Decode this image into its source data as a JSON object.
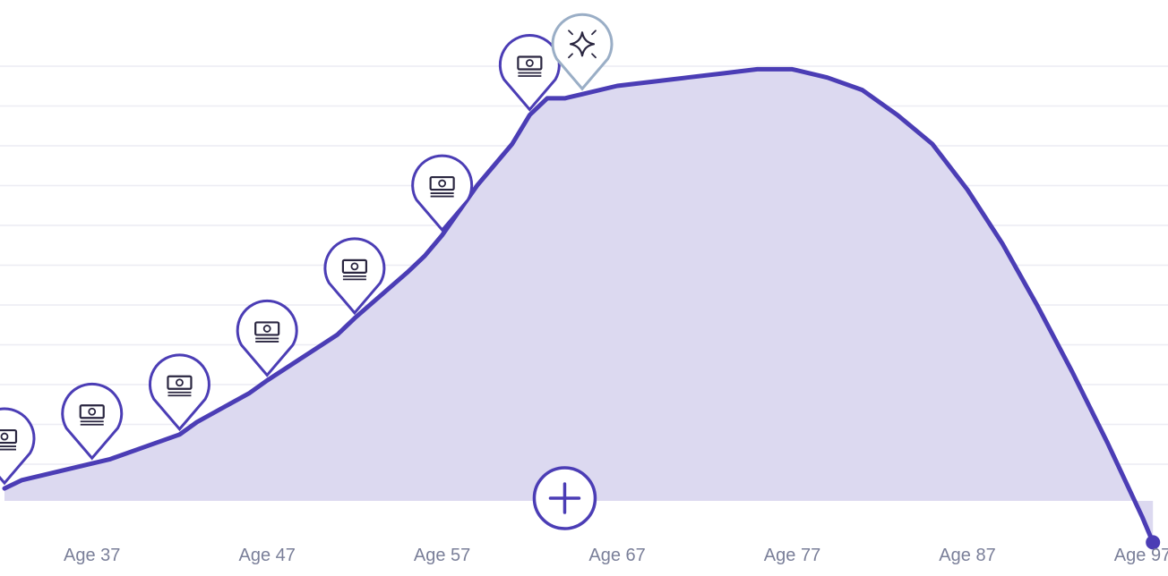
{
  "chart_data": {
    "type": "area",
    "title": "",
    "xlabel": "",
    "ylabel": "",
    "xlim": [
      32,
      98
    ],
    "ylim": [
      0,
      100
    ],
    "grid": true,
    "tick_labels": [
      "Age 37",
      "Age 47",
      "Age 57",
      "Age 67",
      "Age 77",
      "Age 87",
      "Age 97"
    ],
    "tick_values": [
      37,
      47,
      57,
      67,
      77,
      87,
      97
    ],
    "series": [
      {
        "x": [
          32,
          33,
          37,
          38,
          42,
          43,
          46,
          47,
          51,
          52,
          55,
          56,
          57,
          59,
          61,
          62,
          63,
          64,
          65,
          67,
          69,
          71,
          73,
          75,
          77,
          79,
          81,
          83,
          85,
          87,
          89,
          91,
          93,
          95,
          97,
          97.6
        ],
        "y": [
          3,
          5,
          9,
          10,
          16,
          19,
          26,
          29,
          40,
          44,
          55,
          59,
          64,
          76,
          86,
          93,
          97,
          97,
          98,
          100,
          101,
          102,
          103,
          104,
          104,
          102,
          99,
          93,
          86,
          75,
          62,
          47,
          31,
          14,
          -4,
          -10
        ],
        "color": "#4b3db5",
        "fill": "#dcd9f0"
      }
    ],
    "markers": [
      {
        "age": 32,
        "icon": "cash-icon"
      },
      {
        "age": 37,
        "icon": "cash-icon"
      },
      {
        "age": 42,
        "icon": "cash-icon"
      },
      {
        "age": 47,
        "icon": "cash-icon"
      },
      {
        "age": 52,
        "icon": "cash-icon"
      },
      {
        "age": 57,
        "icon": "cash-icon"
      },
      {
        "age": 62,
        "icon": "cash-icon"
      },
      {
        "age": 65,
        "icon": "sparkle-icon",
        "variant": "retirement"
      }
    ],
    "add_button": {
      "icon": "plus-icon",
      "age": 64
    }
  },
  "colors": {
    "line": "#4b3db5",
    "area": "#dcd9f0",
    "grid": "#ececf3",
    "tick_text": "#7a7f99",
    "marker_retire": "#9aaec6"
  }
}
